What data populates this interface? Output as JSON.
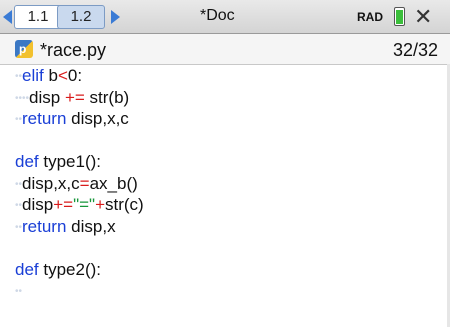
{
  "tabs": [
    {
      "label": "1.1"
    },
    {
      "label": "1.2"
    }
  ],
  "document_title": "*Doc",
  "status": {
    "angle_mode": "RAD"
  },
  "file": {
    "name": "*race.py",
    "line_counter": "32/32"
  },
  "code": {
    "line1": {
      "indent": "••",
      "kw": "elif",
      "rest": " b",
      "op": "<",
      "tail": "0:"
    },
    "line2": {
      "indent": "••••",
      "text": "disp ",
      "op": "+=",
      "tail": " str(b)"
    },
    "line3": {
      "indent": "••",
      "kw": "return",
      "rest": " disp,x,c"
    },
    "line5": {
      "kw": "def",
      "rest": " type1():"
    },
    "line6": {
      "indent": "••",
      "text": "disp,x,c",
      "op": "=",
      "tail": "ax_b()"
    },
    "line7": {
      "indent": "••",
      "text": "disp",
      "op": "+=",
      "str1": "\"=\"",
      "op2": "+",
      "tail": "str(c)"
    },
    "line8": {
      "indent": "••",
      "kw": "return",
      "rest": " disp,x"
    },
    "line10": {
      "kw": "def",
      "rest": " type2():"
    },
    "line11": {
      "indent": "••"
    }
  },
  "colors": {
    "keyword": "#1a3fd6",
    "operator": "#d91b1b",
    "string": "#16963a",
    "tab_accent": "#3a7bd5"
  }
}
